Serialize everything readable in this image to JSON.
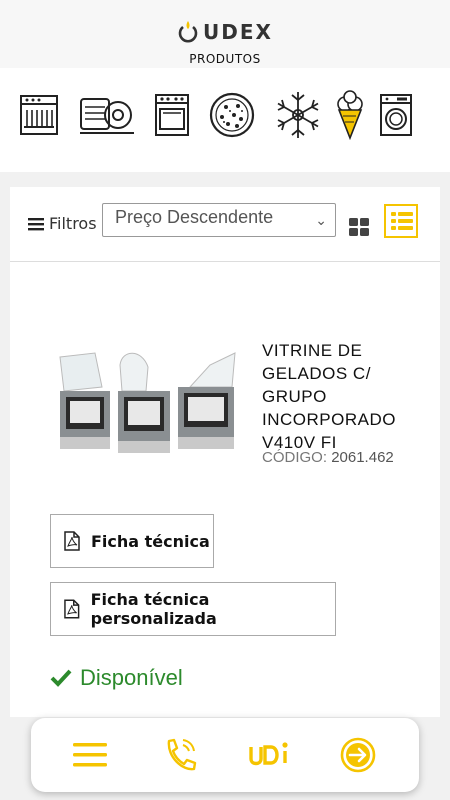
{
  "header": {
    "logo_text": "UDEX",
    "subtitle": "PRODUTOS"
  },
  "categories": [
    {
      "name": "dishwasher-icon"
    },
    {
      "name": "slicer-icon"
    },
    {
      "name": "oven-icon"
    },
    {
      "name": "pizza-icon"
    },
    {
      "name": "snowflake-icon"
    },
    {
      "name": "ice-cream-icon"
    },
    {
      "name": "washing-machine-icon"
    }
  ],
  "toolbar": {
    "filters_label": "Filtros",
    "sort_value": "Preço Descendente"
  },
  "product": {
    "title": "VITRINE DE GELADOS C/ GRUPO INCORPORADO V410V FI",
    "code_label": "CÓDIGO:",
    "code_value": "2061.462",
    "datasheet_label": "Ficha técnica",
    "custom_datasheet_label": "Ficha técnica personalizada",
    "availability": "Disponível"
  },
  "bottom_nav": {
    "logo_text": "UDI"
  },
  "colors": {
    "accent": "#f5c400",
    "available": "#2c8a2c"
  }
}
